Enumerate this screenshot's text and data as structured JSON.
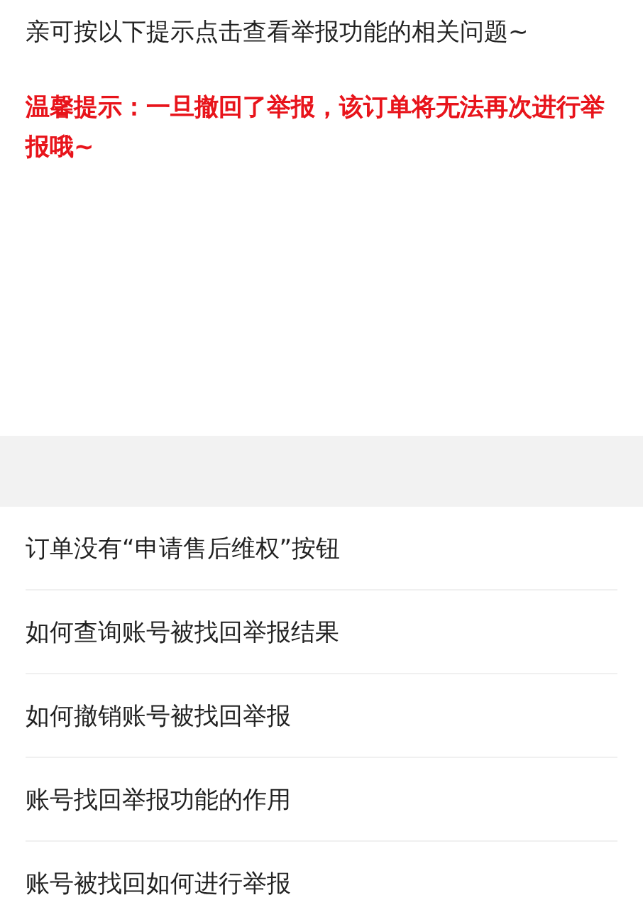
{
  "intro": "亲可按以下提示点击查看举报功能的相关问题~",
  "warning": "温馨提示：一旦撤回了举报，该订单将无法再次进行举报哦~",
  "questions": [
    "订单没有“申请售后维权”按钮",
    "如何查询账号被找回举报结果",
    "如何撤销账号被找回举报",
    "账号找回举报功能的作用",
    "账号被找回如何进行举报"
  ]
}
